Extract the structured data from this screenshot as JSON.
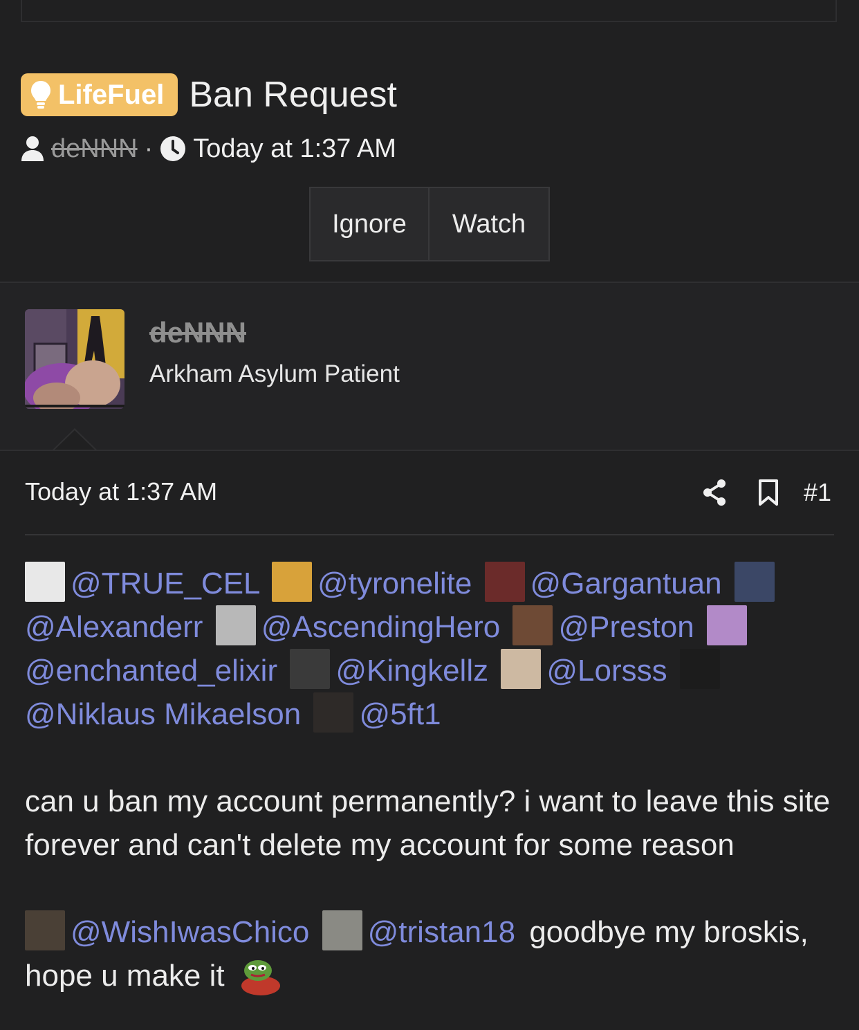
{
  "thread": {
    "prefix": "LifeFuel",
    "title": "Ban Request",
    "starter": "deNNN",
    "separator": "·",
    "started_time": "Today at 1:37 AM",
    "ignore_label": "Ignore",
    "watch_label": "Watch"
  },
  "author": {
    "name": "deNNN",
    "user_title": "Arkham Asylum Patient"
  },
  "post": {
    "time": "Today at 1:37 AM",
    "number": "#1",
    "mentions": [
      "@TRUE_CEL",
      "@tyronelite",
      "@Gargantuan",
      "@Alexanderr",
      "@AscendingHero",
      "@Preston",
      "@enchanted_elixir",
      "@Kingkellz",
      "@Lorsss",
      "@Niklaus Mikaelson",
      "@5ft1"
    ],
    "message": "can u ban my account permanently? i want to leave this site forever and can't delete my account for some reason",
    "closing_mentions": [
      "@WishIwasChico",
      "@tristan18"
    ],
    "closing_text": "goodbye my broskis, hope u make it"
  },
  "colors": {
    "background": "#202021",
    "prefix_bg": "#f3c167",
    "mention": "#7f8bdc"
  },
  "icons": [
    "lightbulb-icon",
    "user-icon",
    "clock-icon",
    "share-icon",
    "bookmark-icon",
    "pepe-emoji"
  ]
}
